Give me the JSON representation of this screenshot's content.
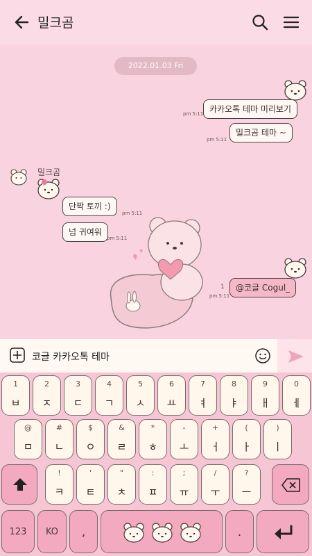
{
  "header": {
    "title": "밀크곰"
  },
  "chat": {
    "date": "2022.01.03 Fri",
    "outgoing": [
      {
        "text": "카카오톡 테마 미리보기",
        "time": "pm 5:11"
      },
      {
        "text": "밀크곰 테마 ~",
        "time": "pm 5:11"
      }
    ],
    "incoming_sender": "밀크곰",
    "incoming": [
      {
        "text": "단짝 토끼 :)",
        "time": "pm 5:11"
      },
      {
        "text": "넘 귀여워",
        "time": "pm 5:11"
      }
    ],
    "last_outgoing": {
      "text": "@코글 Cogul_",
      "time": "pm 5:11",
      "unread": "1"
    }
  },
  "input": {
    "value": "코글 카카오톡 테마"
  },
  "keyboard": {
    "row1": [
      {
        "sub": "1",
        "main": "ㅂ"
      },
      {
        "sub": "2",
        "main": "ㅈ"
      },
      {
        "sub": "3",
        "main": "ㄷ"
      },
      {
        "sub": "4",
        "main": "ㄱ"
      },
      {
        "sub": "5",
        "main": "ㅅ"
      },
      {
        "sub": "6",
        "main": "ㅛ"
      },
      {
        "sub": "7",
        "main": "ㅕ"
      },
      {
        "sub": "8",
        "main": "ㅑ"
      },
      {
        "sub": "9",
        "main": "ㅐ"
      },
      {
        "sub": "0",
        "main": "ㅔ"
      }
    ],
    "row2": [
      {
        "sub": "@",
        "main": "ㅁ"
      },
      {
        "sub": "#",
        "main": "ㄴ"
      },
      {
        "sub": "$",
        "main": "ㅇ"
      },
      {
        "sub": "&",
        "main": "ㄹ"
      },
      {
        "sub": "*",
        "main": "ㅎ"
      },
      {
        "sub": "-",
        "main": "ㅗ"
      },
      {
        "sub": "+",
        "main": "ㅓ"
      },
      {
        "sub": "(",
        "main": "ㅏ"
      },
      {
        "sub": ")",
        "main": "ㅣ"
      }
    ],
    "row3": [
      {
        "sub": "!",
        "main": "ㅋ"
      },
      {
        "sub": "'",
        "main": "ㅌ"
      },
      {
        "sub": "\"",
        "main": "ㅊ"
      },
      {
        "sub": ":",
        "main": "ㅍ"
      },
      {
        "sub": ";",
        "main": "ㅠ"
      },
      {
        "sub": "/",
        "main": "ㅜ"
      },
      {
        "sub": "?",
        "main": "ㅡ"
      }
    ],
    "symbols_label": "123",
    "lang_label": "KO",
    "comma_label": ",",
    "period_label": "."
  }
}
